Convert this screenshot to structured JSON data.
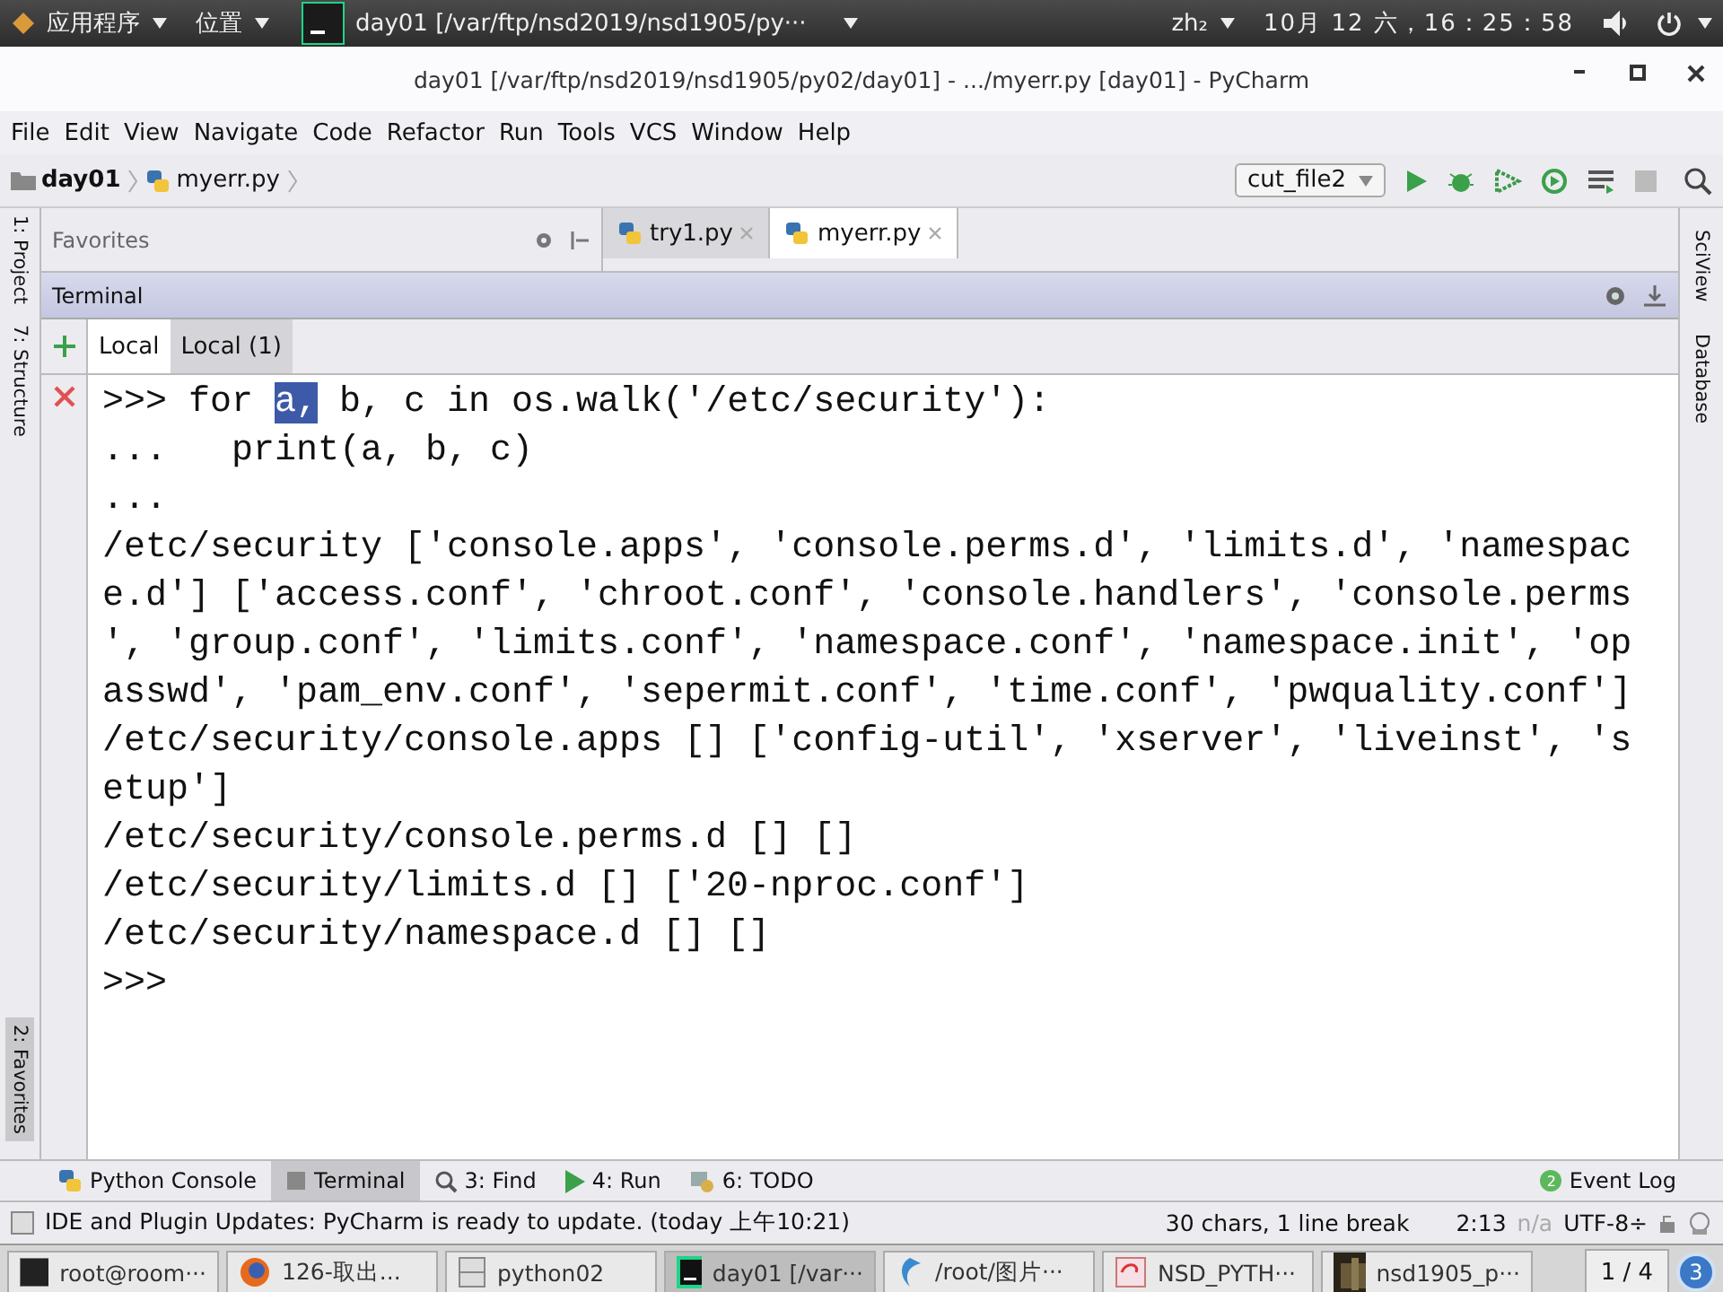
{
  "top_panel": {
    "apps_menu": "应用程序",
    "places_menu": "位置",
    "active_window": "day01 [/var/ftp/nsd2019/nsd1905/py···",
    "input_method": "zh₂",
    "clock": "10月 12 六，16：25：58"
  },
  "window": {
    "title": "day01 [/var/ftp/nsd2019/nsd1905/py02/day01] - .../myerr.py [day01] - PyCharm"
  },
  "menu": [
    "File",
    "Edit",
    "View",
    "Navigate",
    "Code",
    "Refactor",
    "Run",
    "Tools",
    "VCS",
    "Window",
    "Help"
  ],
  "breadcrumb": [
    "day01",
    "myerr.py"
  ],
  "run_config": "cut_file2",
  "left_stripe": [
    {
      "label": "1: Project",
      "selected": false
    },
    {
      "label": "7: Structure",
      "selected": false
    },
    {
      "label": "2: Favorites",
      "selected": true
    }
  ],
  "favorites": {
    "title": "Favorites"
  },
  "editor_tabs": [
    {
      "label": "try1.py",
      "selected": false
    },
    {
      "label": "myerr.py",
      "selected": true
    }
  ],
  "terminal": {
    "title": "Terminal",
    "tabs": [
      {
        "label": "Local",
        "selected": true
      },
      {
        "label": "Local (1)",
        "selected": false
      }
    ],
    "lines": [
      [
        {
          "text": ">>> for ",
          "selected": false
        },
        {
          "text": "a,",
          "selected": true
        },
        {
          "text": " b, c in os.walk('/etc/security'):",
          "selected": false
        }
      ],
      [
        {
          "text": "...   print(a, b, c)",
          "selected": false
        }
      ],
      [
        {
          "text": "...",
          "selected": false
        }
      ],
      [
        {
          "text": "/etc/security ['console.apps', 'console.perms.d', 'limits.d', 'namespac",
          "selected": false
        }
      ],
      [
        {
          "text": "e.d'] ['access.conf', 'chroot.conf', 'console.handlers', 'console.perms",
          "selected": false
        }
      ],
      [
        {
          "text": "', 'group.conf', 'limits.conf', 'namespace.conf', 'namespace.init', 'op",
          "selected": false
        }
      ],
      [
        {
          "text": "asswd', 'pam_env.conf', 'sepermit.conf', 'time.conf', 'pwquality.conf']",
          "selected": false
        }
      ],
      [
        {
          "text": "/etc/security/console.apps [] ['config-util', 'xserver', 'liveinst', 's",
          "selected": false
        }
      ],
      [
        {
          "text": "etup']",
          "selected": false
        }
      ],
      [
        {
          "text": "/etc/security/console.perms.d [] []",
          "selected": false
        }
      ],
      [
        {
          "text": "/etc/security/limits.d [] ['20-nproc.conf']",
          "selected": false
        }
      ],
      [
        {
          "text": "/etc/security/namespace.d [] []",
          "selected": false
        }
      ],
      [
        {
          "text": ">>>",
          "selected": false
        }
      ]
    ]
  },
  "right_stripe": [
    "SciView",
    "Database"
  ],
  "bottom_tabs": [
    {
      "label": "Python Console",
      "kind": "python",
      "selected": false
    },
    {
      "label": "Terminal",
      "kind": "terminal",
      "selected": true
    },
    {
      "label": "3: Find",
      "kind": "find",
      "selected": false
    },
    {
      "label": "4: Run",
      "kind": "run",
      "selected": false
    },
    {
      "label": "6: TODO",
      "kind": "todo",
      "selected": false
    }
  ],
  "event_log": {
    "badge": "2",
    "label": "Event Log"
  },
  "status_bar": {
    "message": "IDE and Plugin Updates: PyCharm is ready to update. (today 上午10:21)",
    "selection": "30 chars, 1 line break",
    "position": "2:13",
    "line_separator": "n/a",
    "encoding": "UTF-8÷"
  },
  "taskbar": {
    "items": [
      {
        "label": "root@room···",
        "kind": "terminal",
        "selected": false
      },
      {
        "label": "126-取出...",
        "kind": "browser",
        "selected": false
      },
      {
        "label": "python02",
        "kind": "files",
        "selected": false
      },
      {
        "label": "day01 [/var···",
        "kind": "pycharm",
        "selected": true
      },
      {
        "label": "/root/图片···",
        "kind": "viewer",
        "selected": false
      },
      {
        "label": "NSD_PYTH···",
        "kind": "document",
        "selected": false
      },
      {
        "label": "nsd1905_p···",
        "selected": false
      }
    ],
    "workspace": "1 / 4",
    "notifications": "3"
  }
}
